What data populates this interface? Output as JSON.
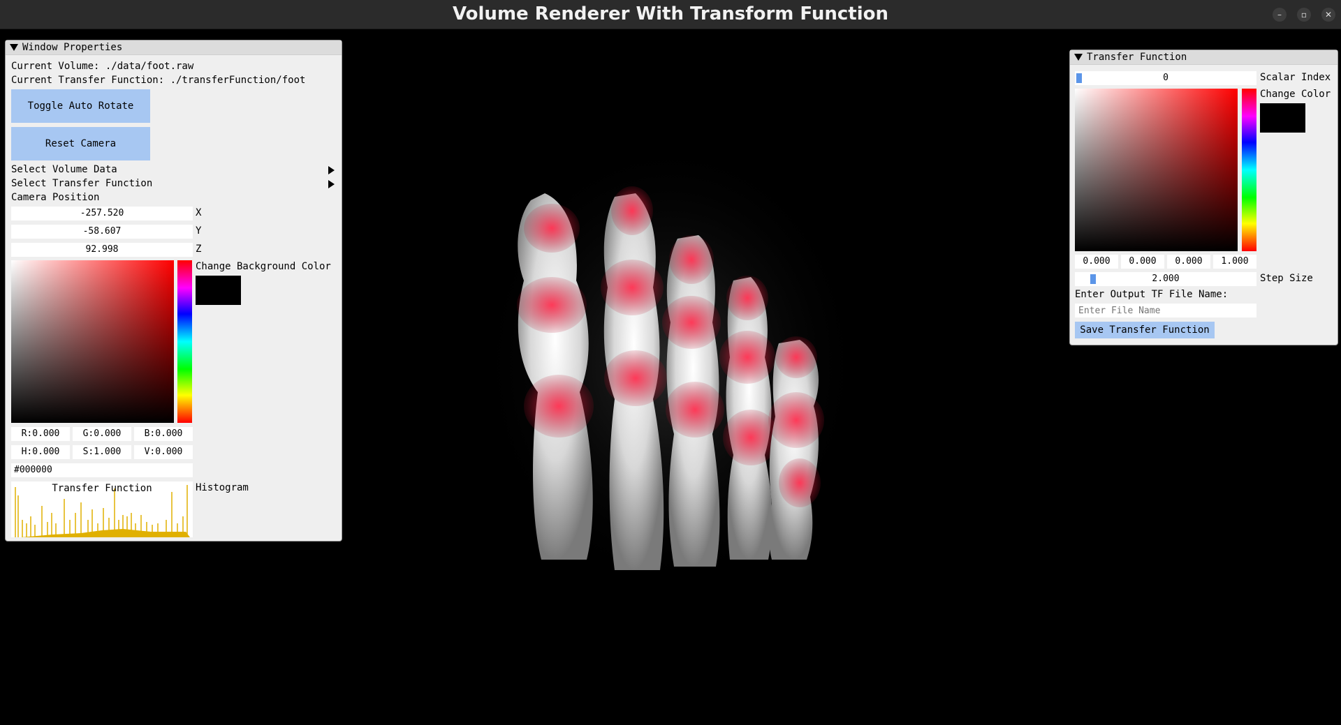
{
  "window": {
    "title": "Volume Renderer With Transform Function",
    "minimize_icon": "minimize-icon",
    "restore_icon": "restore-icon",
    "close_icon": "close-icon"
  },
  "properties_panel": {
    "header": "Window Properties",
    "current_volume": "Current Volume: ./data/foot.raw",
    "current_tf": "Current Transfer Function: ./transferFunction/foot",
    "toggle_rotate": "Toggle Auto Rotate",
    "reset_camera": "Reset Camera",
    "select_volume": "Select Volume Data",
    "select_tf": "Select Transfer Function",
    "camera_position_label": "Camera Position",
    "camera": {
      "x_value": "-257.520",
      "x_label": "X",
      "y_value": "-58.607",
      "y_label": "Y",
      "z_value": "92.998",
      "z_label": "Z"
    },
    "bg_color_label": "Change Background Color",
    "rgb": {
      "r": "R:0.000",
      "g": "G:0.000",
      "b": "B:0.000"
    },
    "hsv": {
      "h": "H:0.000",
      "s": "S:1.000",
      "v": "V:0.000"
    },
    "hex": "#000000",
    "histogram_title": "Transfer Function",
    "histogram_label": "Histogram",
    "histogram_color": "#e0b000",
    "background_color": "#000000"
  },
  "tf_panel": {
    "header": "Transfer Function",
    "scalar_index_value": "0",
    "scalar_index_label": "Scalar Index",
    "change_color_label": "Change Color",
    "rgba": [
      "0.000",
      "0.000",
      "0.000",
      "1.000"
    ],
    "step_size_value": "2.000",
    "step_size_label": "Step Size",
    "output_label": "Enter Output TF File Name:",
    "file_placeholder": "Enter File Name",
    "save_button": "Save Transfer Function"
  },
  "render": {
    "subject": "foot-bones-volume",
    "tint_color": "#e0203c"
  }
}
